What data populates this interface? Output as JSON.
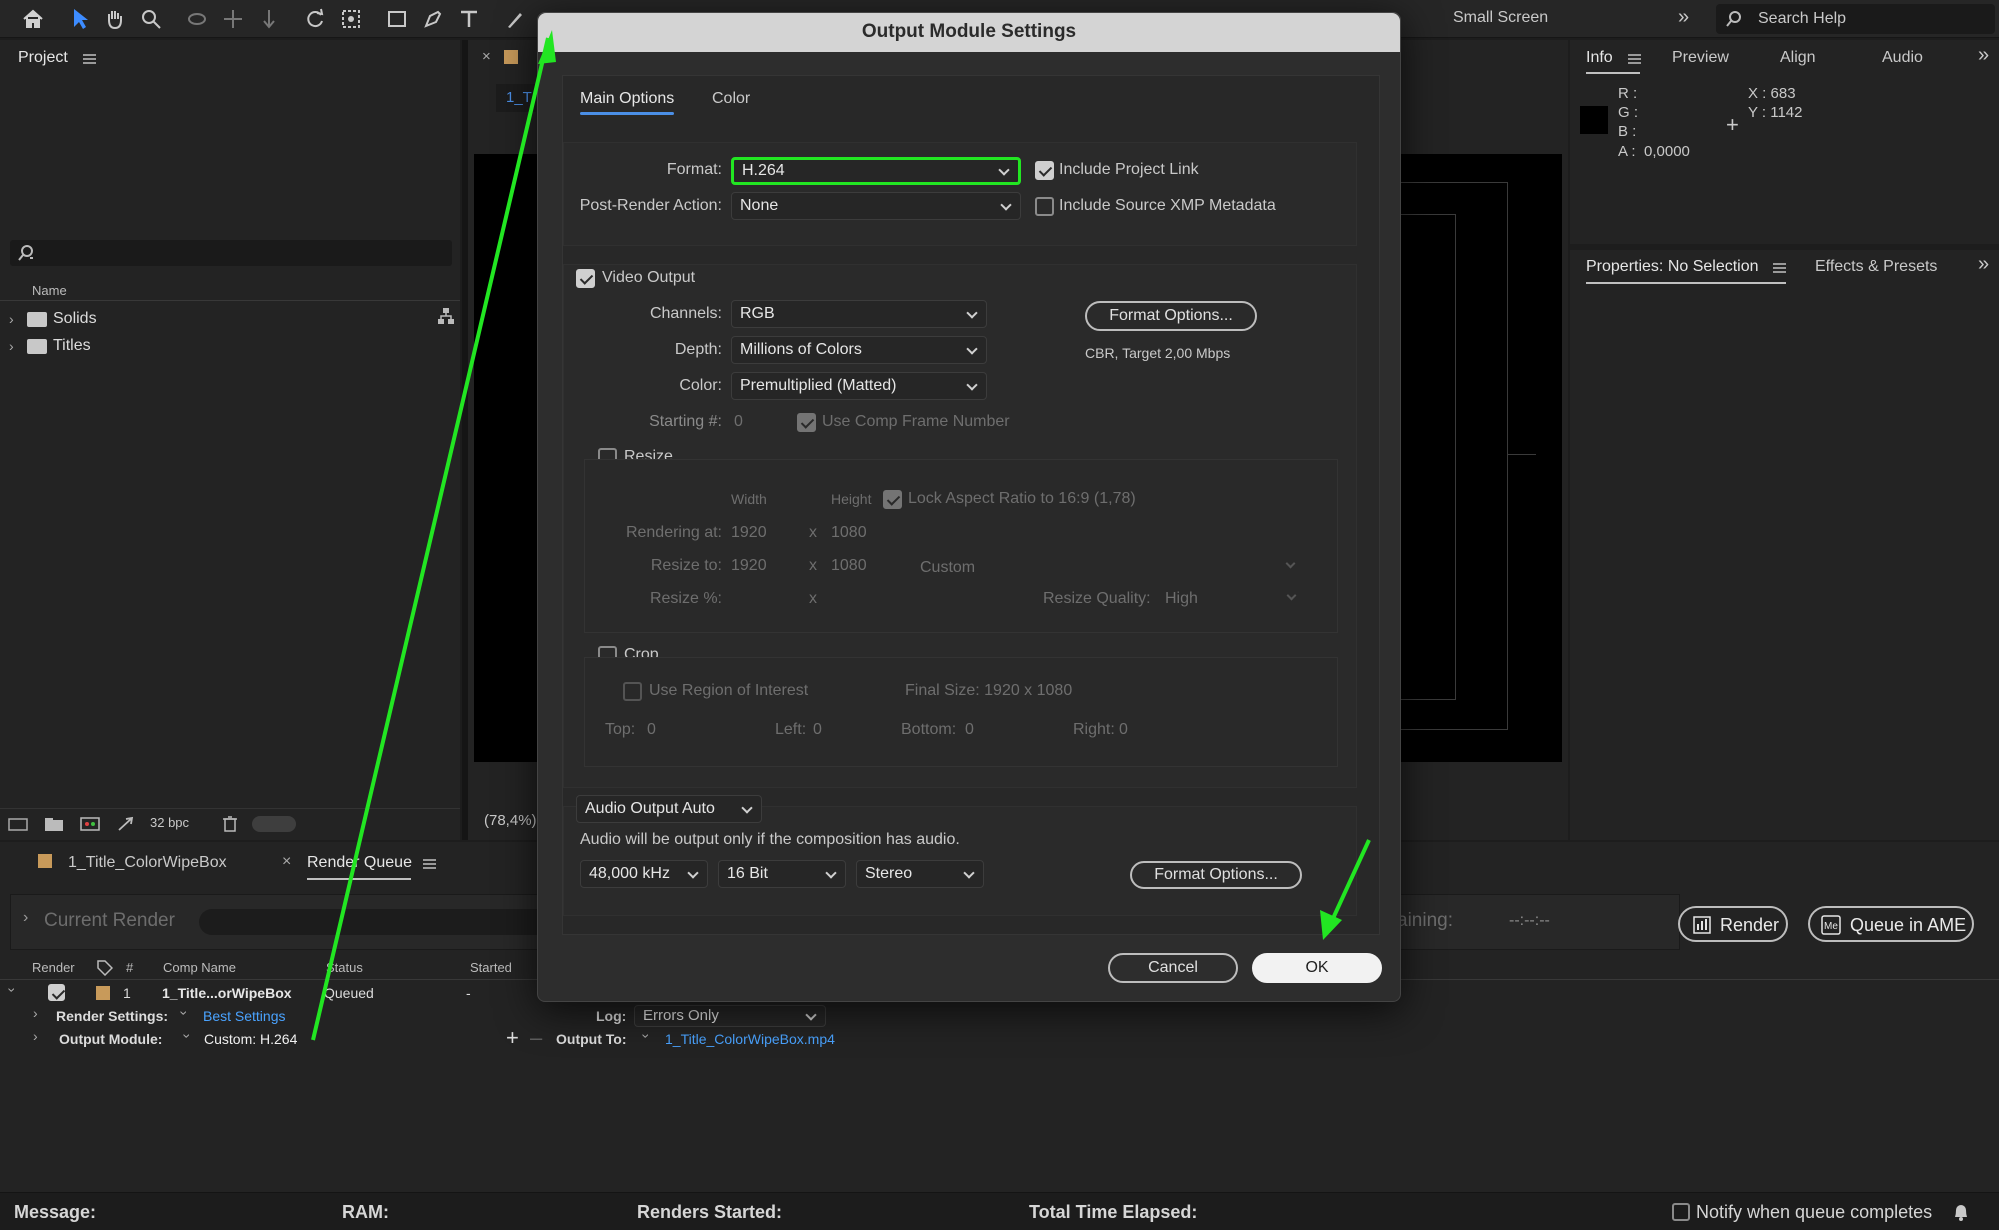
{
  "toolbar": {
    "workspace": "Small Screen",
    "search_placeholder": "Search Help"
  },
  "project": {
    "title": "Project",
    "search_icon_text": "⌕",
    "column_name": "Name",
    "items": [
      {
        "label": "Solids"
      },
      {
        "label": "Titles"
      }
    ],
    "bpc": "32 bpc"
  },
  "comp": {
    "tab_label": "1_T",
    "zoom": "(78,4%)"
  },
  "info": {
    "tabs": [
      "Info",
      "Preview",
      "Align",
      "Audio"
    ],
    "r": "R :",
    "g": "G :",
    "b": "B :",
    "a": "A :",
    "a_value": "0,0000",
    "x": "X : 683",
    "y": "Y : 1142"
  },
  "properties": {
    "tabs": [
      "Properties: No Selection",
      "Effects & Presets"
    ]
  },
  "bottom_tabs": {
    "comp": "1_Title_ColorWipeBox",
    "render_queue": "Render Queue"
  },
  "render_queue": {
    "current_render": "Current Render",
    "remaining_label": "aining:",
    "remaining_value": "--:--:--",
    "render_button": "Render",
    "ame_button": "Queue in AME",
    "columns": {
      "render": "Render",
      "num": "#",
      "comp": "Comp Name",
      "status": "Status",
      "started": "Started"
    },
    "row": {
      "num": "1",
      "comp": "1_Title...orWipeBox",
      "status": "Queued",
      "started": "-"
    },
    "render_settings_label": "Render Settings:",
    "render_settings_value": "Best Settings",
    "output_module_label": "Output Module:",
    "output_module_value": "Custom: H.264",
    "log_label": "Log:",
    "log_value": "Errors Only",
    "output_to_label": "Output To:",
    "output_to_value": "1_Title_ColorWipeBox.mp4"
  },
  "status_bar": {
    "message": "Message:",
    "ram": "RAM:",
    "renders_started": "Renders Started:",
    "total_time": "Total Time Elapsed:",
    "notify": "Notify when queue completes"
  },
  "dialog": {
    "title": "Output Module Settings",
    "tabs": {
      "main": "Main Options",
      "color": "Color"
    },
    "format_label": "Format:",
    "format_value": "H.264",
    "post_render_label": "Post-Render Action:",
    "post_render_value": "None",
    "include_project_link": "Include Project Link",
    "include_xmp": "Include Source XMP Metadata",
    "video_output": "Video Output",
    "channels_label": "Channels:",
    "channels_value": "RGB",
    "depth_label": "Depth:",
    "depth_value": "Millions of Colors",
    "color_label": "Color:",
    "color_value": "Premultiplied (Matted)",
    "starting_label": "Starting #:",
    "starting_value": "0",
    "use_comp_frame": "Use Comp Frame Number",
    "format_options": "Format Options...",
    "format_info": "CBR, Target 2,00 Mbps",
    "resize": "Resize",
    "width": "Width",
    "height": "Height",
    "lock_aspect": "Lock Aspect Ratio to 16:9 (1,78)",
    "rendering_at": "Rendering at:",
    "rendering_w": "1920",
    "rendering_h": "1080",
    "resize_to": "Resize to:",
    "resize_w": "1920",
    "resize_h": "1080",
    "resize_preset": "Custom",
    "resize_pct": "Resize %:",
    "x": "x",
    "resize_quality_label": "Resize Quality:",
    "resize_quality_value": "High",
    "crop": "Crop",
    "use_roi": "Use Region of Interest",
    "final_size": "Final Size: 1920 x 1080",
    "top": "Top:",
    "top_v": "0",
    "left": "Left:",
    "left_v": "0",
    "bottom": "Bottom:",
    "bottom_v": "0",
    "right": "Right:",
    "right_v": "0",
    "audio_output": "Audio Output Auto",
    "audio_note": "Audio will be output only if the composition has audio.",
    "sample_rate": "48,000 kHz",
    "bit_depth": "16 Bit",
    "channels_audio": "Stereo",
    "audio_format_options": "Format Options...",
    "cancel": "Cancel",
    "ok": "OK"
  },
  "colors": {
    "highlight": "#22e622",
    "accent_blue": "#4b8fe6",
    "link": "#4aa3ff"
  }
}
